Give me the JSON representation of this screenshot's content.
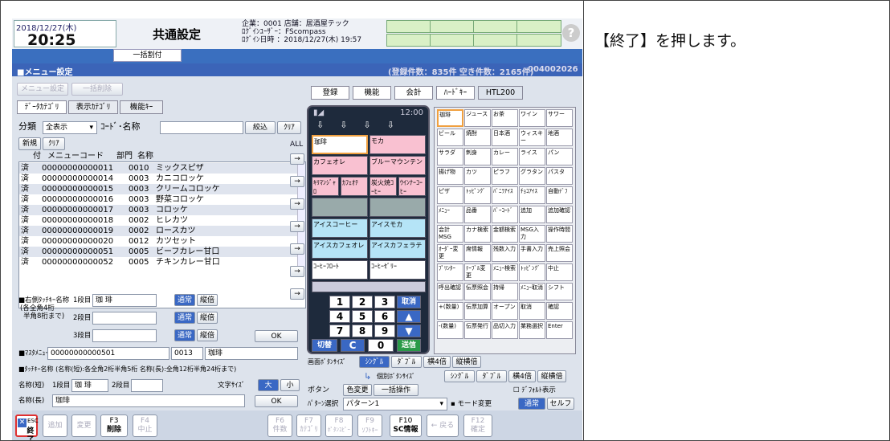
{
  "instruction": "【終了】を押します。",
  "header": {
    "date": "2018/12/27(木)",
    "time": "20:25",
    "title": "共通設定",
    "info": [
      "企業：0001 店舗：居酒屋テック",
      "ﾛｸﾞｲﾝﾕｰｻﾞｰ：FScompass",
      "ﾛｸﾞｲﾝ日時 ：2018/12/27(木) 19:57"
    ],
    "help": "?",
    "subtab": "一括割付"
  },
  "section": {
    "title": "■メニュー設定",
    "counts": "(登録件数：835件 空き件数：2165件)",
    "code": "004002026"
  },
  "left": {
    "menu_btn": "メニュー設定",
    "bulk_btn": "一括削除",
    "tabs": [
      "ﾃﾞｰﾀｶﾃｺﾞﾘ",
      "表示ｶﾃｺﾞﾘ",
      "機能ｷｰ"
    ],
    "bunrui": "分類",
    "bunrui_value": "全表示",
    "code_label": "ｺｰﾄﾞ･名称",
    "narrow": "絞込",
    "clear": "ｸﾘｱ",
    "new": "新規",
    "clear2": "ｸﾘｱ",
    "headers": [
      "付",
      "メニューコード",
      "部門",
      "名称"
    ]
  },
  "rows": [
    {
      "m": "済",
      "code": "00000000000011",
      "dept": "0010",
      "name": "ミックスピザ"
    },
    {
      "m": "済",
      "code": "00000000000014",
      "dept": "0003",
      "name": "カニコロッケ"
    },
    {
      "m": "済",
      "code": "00000000000015",
      "dept": "0003",
      "name": "クリームコロッケ"
    },
    {
      "m": "済",
      "code": "00000000000016",
      "dept": "0003",
      "name": "野菜コロッケ"
    },
    {
      "m": "済",
      "code": "00000000000017",
      "dept": "0003",
      "name": "コロッケ"
    },
    {
      "m": "済",
      "code": "00000000000018",
      "dept": "0002",
      "name": "ヒレカツ"
    },
    {
      "m": "済",
      "code": "00000000000019",
      "dept": "0002",
      "name": "ロースカツ"
    },
    {
      "m": "済",
      "code": "00000000000020",
      "dept": "0012",
      "name": "カツセット"
    },
    {
      "m": "済",
      "code": "00000000000051",
      "dept": "0005",
      "name": "ビーフカレー甘口"
    },
    {
      "m": "済",
      "code": "00000000000052",
      "dept": "0005",
      "name": "チキンカレー甘口"
    }
  ],
  "form": {
    "right_touch": "■右側ﾀｯﾁｷｰ名称",
    "note1": "(各全角4桁",
    "note2": "半角8桁まで)",
    "row1": "1段目",
    "row2": "2段目",
    "row3": "3段目",
    "val1": "珈 琲",
    "normal": "通常",
    "vert": "縦倍",
    "ok": "OK",
    "master_label": "■ﾏｽﾀﾒﾆｭｰ",
    "master_code": "00000000000501",
    "master_dept": "0013",
    "master_name": "珈琲",
    "touch_note": "■ﾀｯﾁｷｰ名称 (名称(短):各全角2桁半角5桁 名称(長):全角12桁半角24桁まで)",
    "short_label": "名称(短)",
    "short_1": "1段目",
    "short_val": "珈 琲",
    "short_2": "2段目",
    "char_size": "文字ｻｲｽﾞ",
    "big": "大",
    "small": "小",
    "long_label": "名称(長)",
    "long_val": "珈琲",
    "ok2": "OK"
  },
  "right": {
    "tabs": [
      "登録",
      "機能",
      "会計",
      "ﾊｰﾄﾞｷｰ",
      "HTL200"
    ],
    "phone_time": "12:00",
    "all": "ALL",
    "keys": [
      "珈琲",
      "モカ",
      "カフェオレ",
      "ブルーマウンテン",
      "ｷﾘﾏﾝｼﾞｬﾛ",
      "ｶﾌｪｵﾃ",
      "炭火焼ｺｰﾋｰ",
      "ｳｲﾝﾅｰｺｰﾋｰ",
      "",
      "",
      "アイスコーヒー",
      "アイスモカ",
      "アイスカフェオレ",
      "アイスカフェラテ",
      "ｺｰﾋｰﾌﾛｰﾄ",
      "ｺｰﾋｰｾﾞﾘｰ"
    ],
    "num_rows": [
      [
        "1",
        "2",
        "3"
      ],
      [
        "4",
        "5",
        "6"
      ],
      [
        "7",
        "8",
        "9"
      ]
    ],
    "cancel": "取消",
    "kiri": "切替",
    "c": "C",
    "zero": "0",
    "send": "送信",
    "grid": [
      "珈琲",
      "ジュース",
      "お茶",
      "ワイン",
      "サワー",
      "ビール",
      "焼酎",
      "日本酒",
      "ウィスキー",
      "地酒",
      "サラダ",
      "刺身",
      "カレー",
      "ライス",
      "パン",
      "揚げ物",
      "カツ",
      "ピラフ",
      "グラタン",
      "パスタ",
      "ピザ",
      "ﾄｯﾋﾟﾝｸﾞ",
      "ﾊﾞﾆﾗｱｲｽ",
      "ﾁｮｺｱｲｽ",
      "自動ﾃﾞﾌ",
      "ﾒﾆｭｰ",
      "品番",
      "ﾊﾞｰｺｰﾄﾞ",
      "追加",
      "追加確認",
      "会計MSG",
      "カナ検索",
      "金額検索",
      "MSG入力",
      "操作時間",
      "ｵｰﾀﾞｰ変更",
      "席情報",
      "残数入力",
      "手書入力",
      "売上照会",
      "ﾌﾟﾘﾝﾀｰ",
      "ﾃｰﾌﾞﾙ変更",
      "ﾒﾆｭｰ検索",
      "ﾄｯﾋﾟﾝｸﾞ",
      "中止",
      "呼出確認",
      "伝票照会",
      "持帰",
      "ﾒﾆｭｰ取消",
      "シフト",
      "+(数量)",
      "伝票加算",
      "オープン",
      "取消",
      "確認",
      "-(数量)",
      "伝票発行",
      "品切入力",
      "業務選択",
      "Enter"
    ]
  },
  "bottom": {
    "screen_size": "画面ﾎﾞﾀﾝｻｲｽﾞ",
    "single": "ｼﾝｸﾞﾙ",
    "double": "ﾀﾞﾌﾞﾙ",
    "h4": "横4倍",
    "vbai": "縦横倍",
    "indiv": "個別ﾎﾞﾀﾝｻｲｽﾞ",
    "button": "ボタン",
    "color": "色変更",
    "bulk": "一括操作",
    "default": "ﾃﾞﾌｫﾙﾄ表示",
    "pattern": "ﾊﾟﾀｰﾝ選択",
    "pattern_val": "パターン1",
    "mode": "モード変更",
    "normal": "通常",
    "self": "セルフ"
  },
  "fkeys": [
    {
      "k": "ESC",
      "l": "終了"
    },
    {
      "k": "",
      "l": "追加"
    },
    {
      "k": "",
      "l": "変更"
    },
    {
      "k": "F3",
      "l": "削除"
    },
    {
      "k": "F4",
      "l": "中止"
    },
    {
      "k": "F6",
      "l": "件数"
    },
    {
      "k": "F7",
      "l": "ｶﾃｺﾞﾘ"
    },
    {
      "k": "F8",
      "l": "ﾎﾟﾀﾝｺﾋﾟｰ"
    },
    {
      "k": "F9",
      "l": "ｿﾌﾄｷｰ"
    },
    {
      "k": "F10",
      "l": "SC情報"
    },
    {
      "k": "",
      "l": "← 戻る"
    },
    {
      "k": "F12",
      "l": "確定"
    }
  ],
  "colors": {
    "accent": "#3a68c4",
    "highlight": "#e03030"
  }
}
